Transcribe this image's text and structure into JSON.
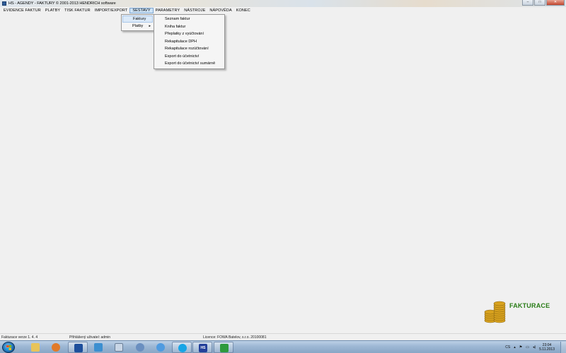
{
  "window": {
    "title": "HS - AGENDY - FAKTURY © 2001-2013 HENDRICH software"
  },
  "caption_buttons": {
    "minimize": "–",
    "maximize": "□",
    "close": "✕"
  },
  "menubar": {
    "items": [
      {
        "label": "EVIDENCE FAKTUR"
      },
      {
        "label": "PLATBY"
      },
      {
        "label": "TISK FAKTUR"
      },
      {
        "label": "IMPORT/EXPORT"
      },
      {
        "label": "SESTAVY"
      },
      {
        "label": "PARAMETRY"
      },
      {
        "label": "NÁSTROJE"
      },
      {
        "label": "NÁPOVĚDA"
      },
      {
        "label": "KONEC"
      }
    ]
  },
  "dropdown": {
    "items": [
      {
        "label": "Faktury"
      },
      {
        "label": "Platby",
        "arrow": "▸"
      }
    ]
  },
  "submenu": {
    "items": [
      {
        "label": "Seznam faktur"
      },
      {
        "label": "Kniha faktur"
      },
      {
        "label": "Přeplatky z vyúčtování"
      },
      {
        "label": "Rekapitulace DPH"
      },
      {
        "label": "Rekapitulace rozúčtování"
      },
      {
        "label": "Export do účetnictví"
      },
      {
        "label": "Export do účetnictví sumárně"
      }
    ]
  },
  "logo": {
    "text": "FAKTURACE",
    "color": "#2a7d18",
    "coin_color": "#d8a21e"
  },
  "statusbar": {
    "version": "Fakturace verze  1. 4. 4",
    "user": "Přihlášený uživatel: admin",
    "license": "Licence:  FOWA Batelov, s.r.o.  20100081"
  },
  "taskbar": {
    "icons": [
      {
        "name": "explorer-icon",
        "color": "#e8c45a"
      },
      {
        "name": "media-player-icon",
        "color": "#e07a2a"
      },
      {
        "name": "save-disk-icon",
        "color": "#1d4f9c"
      },
      {
        "name": "graph-icon",
        "color": "#3c8fd0"
      },
      {
        "name": "document-icon",
        "color": "#c9d6e6"
      },
      {
        "name": "finance-icon",
        "color": "#6a8fc0"
      },
      {
        "name": "globe-icon",
        "color": "#4f9be0"
      },
      {
        "name": "skype-icon",
        "color": "#17a5e6"
      },
      {
        "name": "hs-app-icon",
        "color": "#23409a",
        "label": "HS"
      },
      {
        "name": "spreadsheet-icon",
        "color": "#2e9a3c"
      }
    ],
    "tray": {
      "language": "CS",
      "time": "23:04",
      "date": "5.11.2013"
    }
  }
}
